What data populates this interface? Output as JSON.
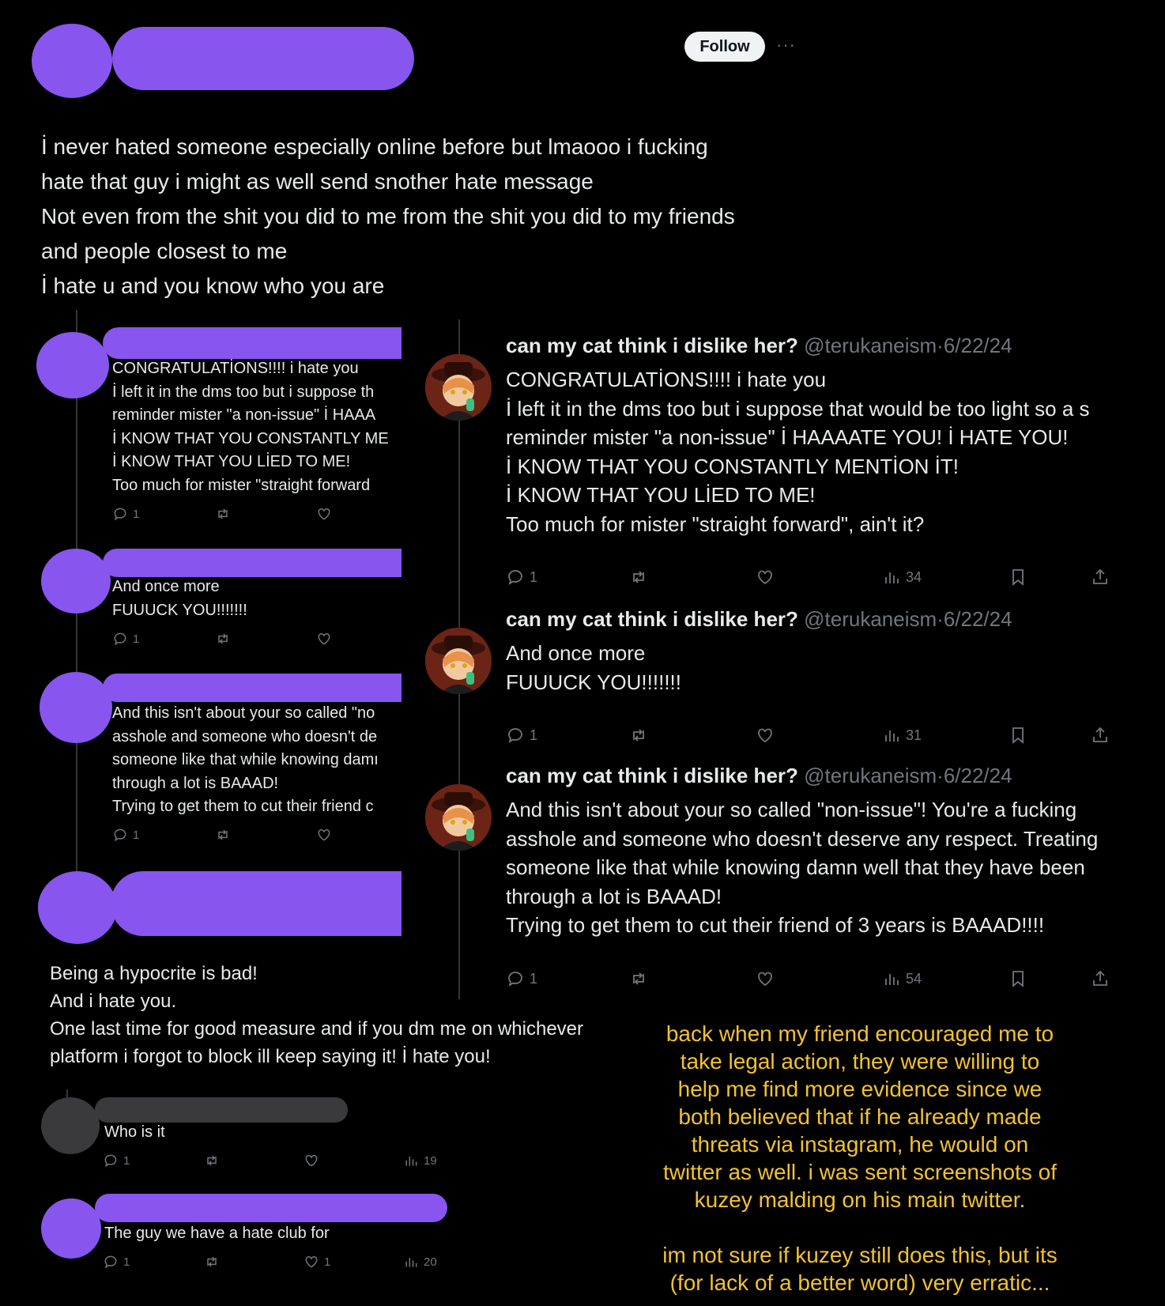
{
  "header": {
    "follow_label": "Follow",
    "more_label": "···"
  },
  "main_tweet": {
    "lines": [
      "İ never hated someone especially online before but lmaooo i fucking",
      "hate that guy i might as well send snother hate message",
      "Not even from the shit you did to me from the shit you did to my friends",
      "and people closest to me",
      "İ hate u and you know who you are"
    ]
  },
  "left_replies": [
    {
      "lines": [
        "CONGRATULATİONS!!!! i hate you",
        "İ left it in the dms too but i suppose th",
        "reminder mister \"a non-issue\" İ HAAA",
        "İ KNOW THAT YOU CONSTANTLY ME",
        "İ KNOW THAT YOU LİED TO ME!",
        "Too much for mister \"straight forward"
      ],
      "replies": "1"
    },
    {
      "lines": [
        "And once more",
        "FUUUCK YOU!!!!!!!"
      ],
      "replies": "1"
    },
    {
      "lines": [
        "And this isn't about your so called \"no",
        "asshole and someone who doesn't de",
        "someone like that while knowing damı",
        "through a lot is BAAAD!",
        "Trying to get them to cut their friend c"
      ],
      "replies": "1"
    }
  ],
  "bottom_reply": {
    "lines": [
      "Being a hypocrite is bad!",
      "And i hate you.",
      "One last time for good measure and if you dm me on whichever",
      "platform i forgot to block ill keep saying it! İ hate you!"
    ]
  },
  "small_replies": [
    {
      "text": "Who is it",
      "replies": "1",
      "likes": "",
      "views": "19"
    },
    {
      "text": "The guy we have a hate club for",
      "replies": "1",
      "likes": "1",
      "views": "20"
    }
  ],
  "right_tweets": [
    {
      "name": "can my cat think i dislike her?",
      "handle": "@terukaneism",
      "sep": "·",
      "date": "6/22/24",
      "lines": [
        "CONGRATULATİONS!!!! i hate you",
        "İ left it in the dms too but i suppose that would be too light so a s",
        "reminder mister \"a non-issue\" İ HAAAATE YOU! İ HATE YOU!",
        "İ KNOW THAT YOU CONSTANTLY MENTİON İT!",
        "İ KNOW THAT YOU LİED TO ME!",
        "Too much for mister \"straight forward\", ain't it?"
      ],
      "replies": "1",
      "views": "34"
    },
    {
      "name": "can my cat think i dislike her?",
      "handle": "@terukaneism",
      "sep": "·",
      "date": "6/22/24",
      "lines": [
        "And once more",
        "FUUUCK YOU!!!!!!!"
      ],
      "replies": "1",
      "views": "31"
    },
    {
      "name": "can my cat think i dislike her?",
      "handle": "@terukaneism",
      "sep": "·",
      "date": "6/22/24",
      "lines": [
        "And this isn't about your so called \"non-issue\"! You're a fucking",
        "asshole and someone who doesn't deserve any respect. Treating",
        "someone like that while knowing damn well that they have been",
        "through a lot is BAAAD!",
        "Trying to get them to cut their friend of 3 years is BAAAD!!!!"
      ],
      "replies": "1",
      "views": "54"
    }
  ],
  "caption": {
    "lines": [
      "back when my friend encouraged me to",
      "take legal action, they were willing to",
      "help me find more evidence since we",
      "both believed that if he already made",
      "threats via instagram, he would on",
      "twitter as well. i was sent screenshots of",
      "kuzey malding on his main twitter.",
      "",
      "im not sure if kuzey still does this, but its",
      "(for lack of a better word) very erratic..."
    ]
  },
  "colors": {
    "redaction": "#8855ee",
    "caption": "#f2c230",
    "muted": "#71767b"
  }
}
